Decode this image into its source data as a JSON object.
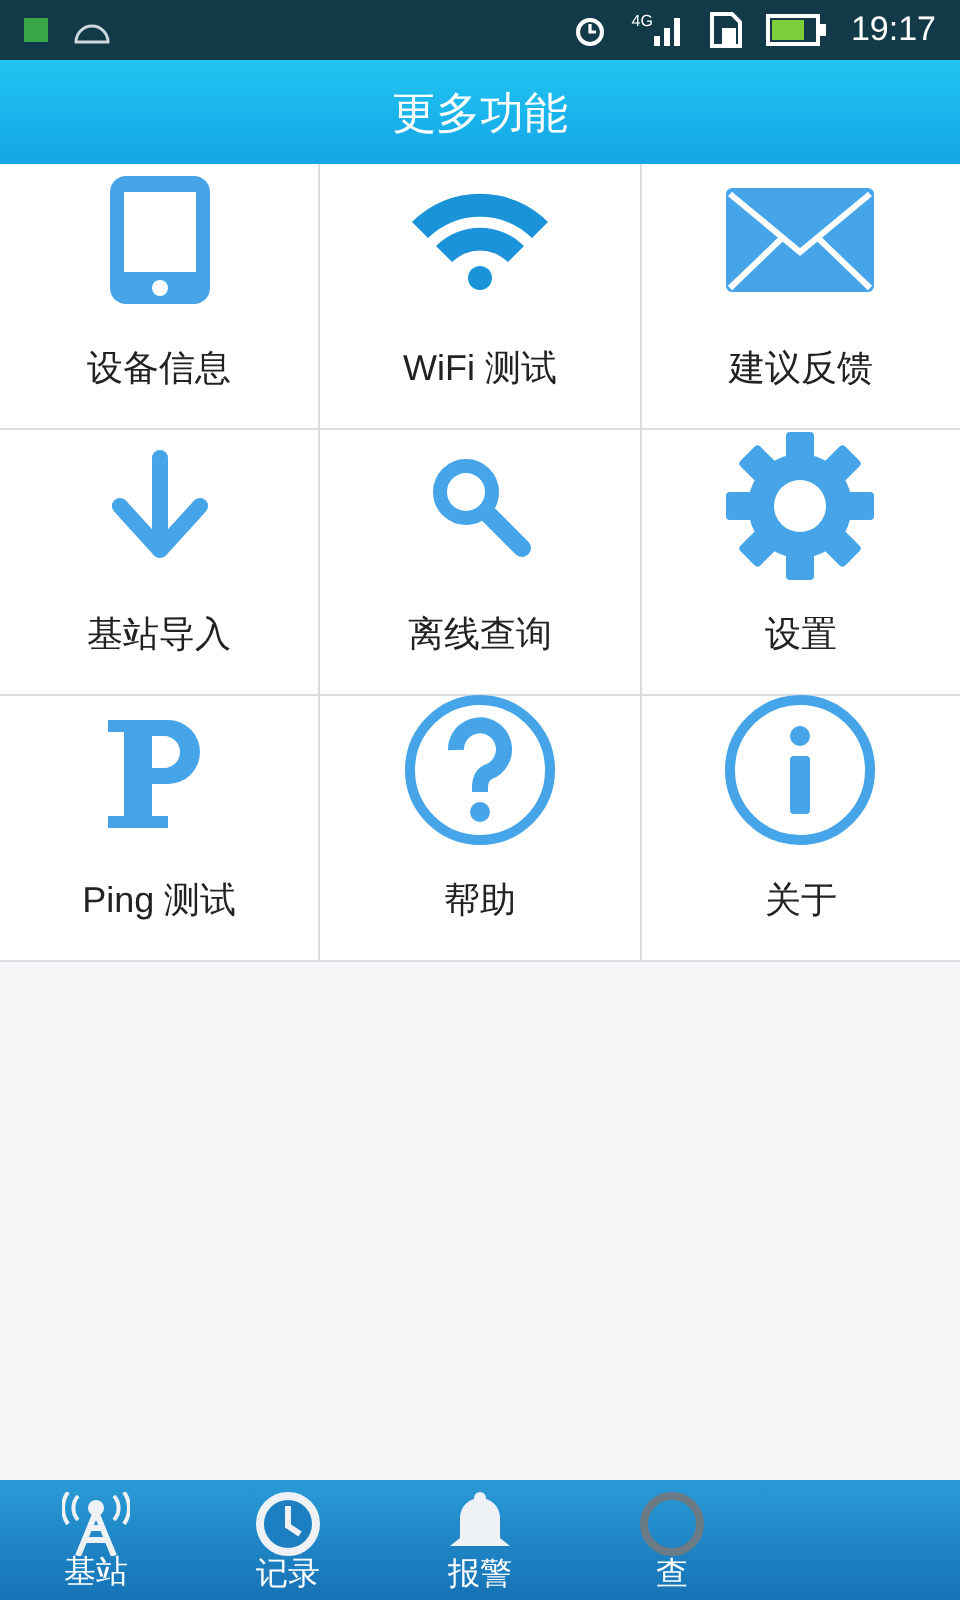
{
  "status_bar": {
    "network": "4G",
    "time": "19:17"
  },
  "header": {
    "title": "更多功能"
  },
  "grid": [
    {
      "label": "设备信息",
      "kind": "phone"
    },
    {
      "label": "WiFi 测试",
      "kind": "wifi"
    },
    {
      "label": "建议反馈",
      "kind": "mail"
    },
    {
      "label": "基站导入",
      "kind": "download"
    },
    {
      "label": "离线查询",
      "kind": "search"
    },
    {
      "label": "设置",
      "kind": "gear"
    },
    {
      "label": "Ping 测试",
      "kind": "ping"
    },
    {
      "label": "帮助",
      "kind": "help"
    },
    {
      "label": "关于",
      "kind": "info"
    }
  ],
  "tab_bar": [
    {
      "label": "基站",
      "kind": "tower"
    },
    {
      "label": "记录",
      "kind": "clock"
    },
    {
      "label": "报警",
      "kind": "bell"
    },
    {
      "label": "查",
      "kind": "query"
    }
  ]
}
